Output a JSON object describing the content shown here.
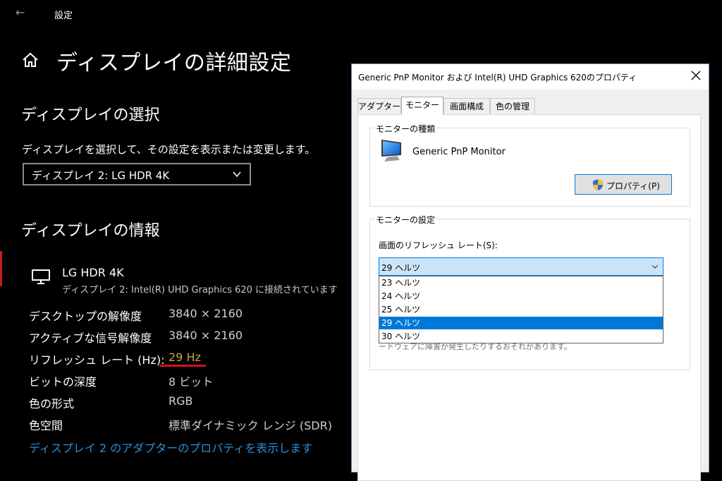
{
  "settings": {
    "back_icon": "back-arrow-icon",
    "app_title": "設定",
    "home_icon": "home-icon",
    "page_title": "ディスプレイの詳細設定",
    "select_section": {
      "heading": "ディスプレイの選択",
      "description": "ディスプレイを選択して、その設定を表示または変更します。",
      "selected_display": "ディスプレイ 2: LG HDR 4K"
    },
    "info_section": {
      "heading": "ディスプレイの情報",
      "monitor_icon": "monitor-icon",
      "display_name": "LG HDR 4K",
      "display_sub": "ディスプレイ 2: Intel(R) UHD Graphics 620 に接続されています",
      "rows": [
        {
          "label": "デスクトップの解像度",
          "value": "3840 × 2160"
        },
        {
          "label": "アクティブな信号解像度",
          "value": "3840 × 2160"
        },
        {
          "label": "リフレッシュ レート (Hz):",
          "value": "29 Hz"
        },
        {
          "label": "ビットの深度",
          "value": "8 ビット"
        },
        {
          "label": "色の形式",
          "value": "RGB"
        },
        {
          "label": "色空間",
          "value": "標準ダイナミック レンジ (SDR)"
        }
      ],
      "link": "ディスプレイ 2 のアダプターのプロパティを表示します"
    }
  },
  "dialog": {
    "title": "Generic PnP Monitor および Intel(R) UHD Graphics 620のプロパティ",
    "close_icon": "close-icon",
    "tabs": [
      {
        "label": "アダプター",
        "active": false
      },
      {
        "label": "モニター",
        "active": true
      },
      {
        "label": "画面構成",
        "active": false
      },
      {
        "label": "色の管理",
        "active": false
      }
    ],
    "monitor_type": {
      "legend": "モニターの種類",
      "monitor_name": "Generic PnP Monitor",
      "properties_button": "プロパティ(P)"
    },
    "monitor_settings": {
      "legend": "モニターの設定",
      "refresh_label": "画面のリフレッシュ レート(S):",
      "combo_value": "29 ヘルツ",
      "options": [
        "23 ヘルツ",
        "24 ヘルツ",
        "25 ヘルツ",
        "29 ヘルツ",
        "30 ヘルツ"
      ],
      "selected_option": "29 ヘルツ",
      "obscured_text": "ードウェアに障害が発生したりするおそれがあります。"
    }
  },
  "colors": {
    "accent_blue": "#0078d7",
    "link_blue": "#2e8ed8",
    "hz_highlight": "#c8a440",
    "underline_red": "#d4101a"
  }
}
